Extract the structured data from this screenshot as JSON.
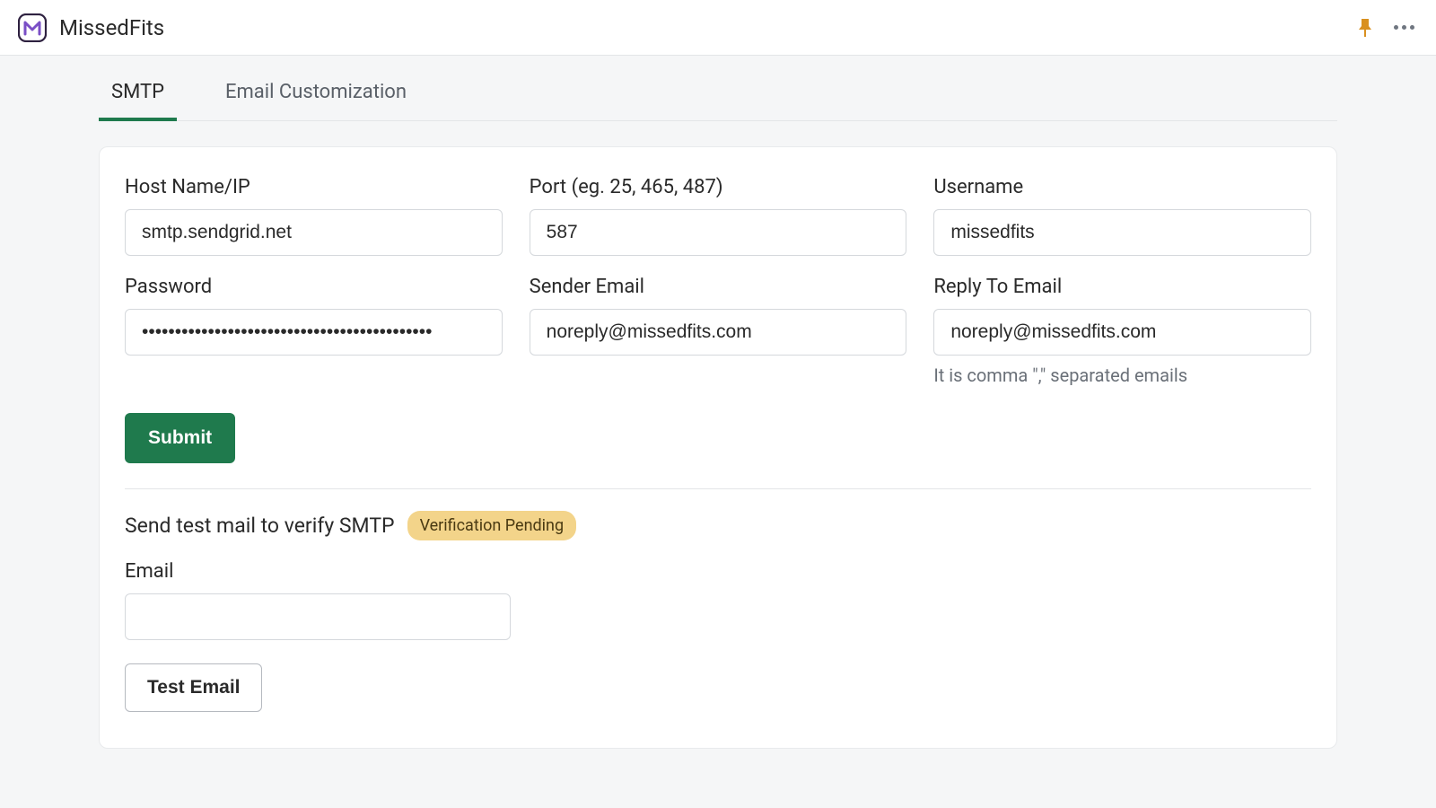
{
  "header": {
    "app_name": "MissedFits"
  },
  "tabs": [
    {
      "label": "SMTP",
      "active": true
    },
    {
      "label": "Email Customization",
      "active": false
    }
  ],
  "form": {
    "host": {
      "label": "Host Name/IP",
      "value": "smtp.sendgrid.net"
    },
    "port": {
      "label": "Port (eg. 25, 465, 487)",
      "value": "587"
    },
    "username": {
      "label": "Username",
      "value": "missedfits"
    },
    "password": {
      "label": "Password",
      "value": "••••••••••••••••••••••••••••••••••••••••••••"
    },
    "sender_email": {
      "label": "Sender Email",
      "value": "noreply@missedfits.com"
    },
    "reply_to": {
      "label": "Reply To Email",
      "value": "noreply@missedfits.com",
      "help": "It is comma \",\" separated emails"
    },
    "submit_label": "Submit"
  },
  "test_section": {
    "heading": "Send test mail to verify SMTP",
    "badge": "Verification Pending",
    "email_label": "Email",
    "email_value": "",
    "button_label": "Test Email"
  }
}
